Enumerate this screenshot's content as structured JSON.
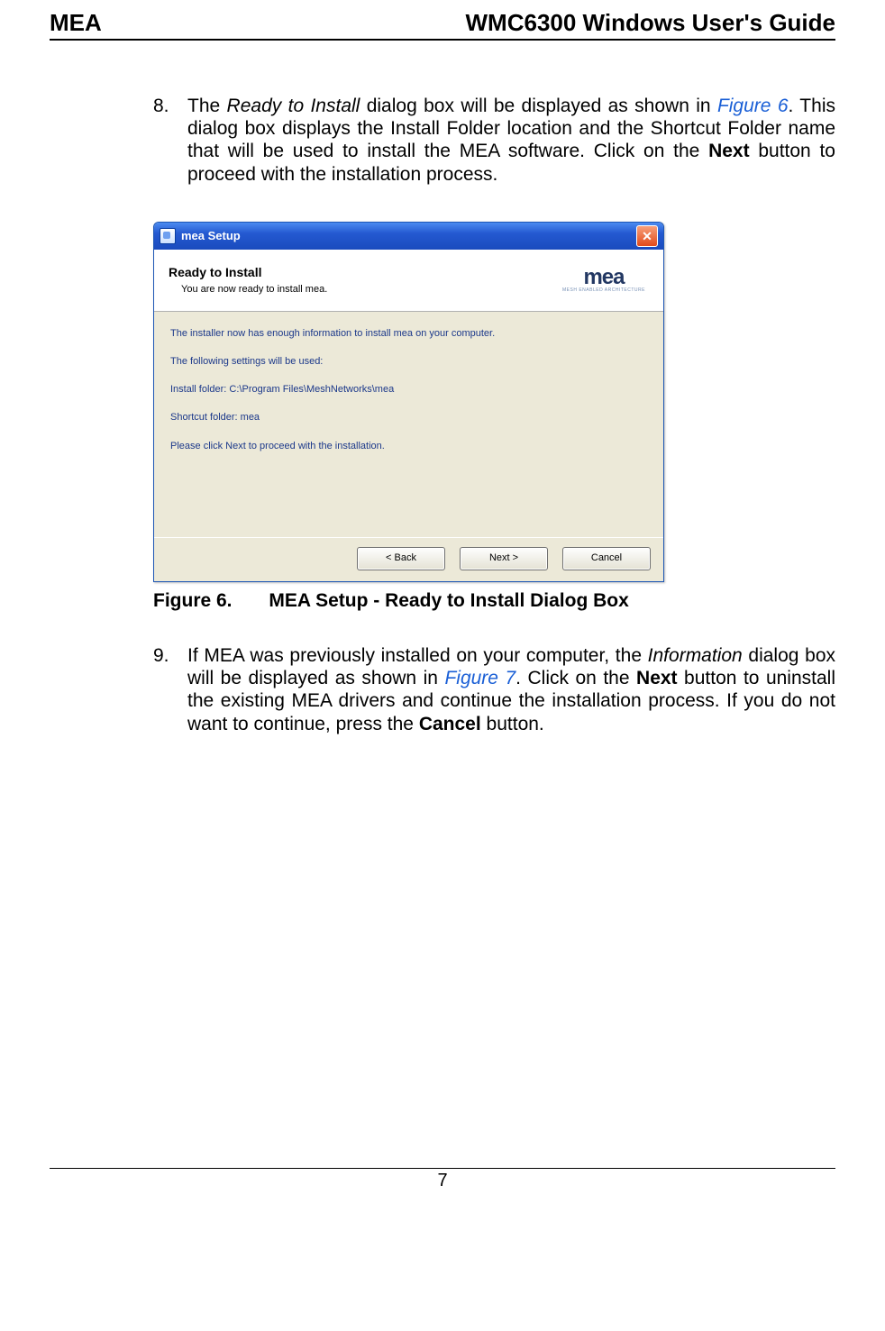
{
  "header": {
    "left": "MEA",
    "right": "WMC6300 Windows User's Guide"
  },
  "steps": {
    "eight": {
      "num": "8.",
      "text_a": "The ",
      "italic_a": "Ready to Install",
      "text_b": " dialog box will be displayed as shown in ",
      "figref": "Figure 6",
      "text_c": ".  This dialog box displays the Install Folder location and the Shortcut Folder name that will be used to install the MEA software.   Click on the ",
      "bold_a": "Next",
      "text_d": " button to proceed with the installation process."
    },
    "nine": {
      "num": "9.",
      "text_a": "If MEA was previously installed on your computer, the ",
      "italic_a": "Information",
      "text_b": " dialog box will be displayed as shown in ",
      "figref": "Figure 7",
      "text_c": ".   Click on the ",
      "bold_a": "Next",
      "text_d": " button to uninstall the existing MEA drivers and continue the installation process.  If you do not want to continue, press the ",
      "bold_b": "Cancel",
      "text_e": " button."
    }
  },
  "dialog": {
    "title": "mea Setup",
    "banner_title": "Ready to Install",
    "banner_sub": "You are now ready to install mea.",
    "logo_main": "mea",
    "logo_sub": "MESH ENABLED ARCHITECTURE",
    "lines": {
      "l1": "The installer now has enough information to install mea on your computer.",
      "l2": "The following settings will be used:",
      "l3": "Install folder: C:\\Program Files\\MeshNetworks\\mea",
      "l4": "Shortcut folder: mea",
      "l5": "Please click Next to proceed with the installation."
    },
    "buttons": {
      "back": "< Back",
      "next": "Next >",
      "cancel": "Cancel"
    }
  },
  "caption": {
    "label": "Figure 6.",
    "text": "MEA Setup - Ready to Install Dialog Box"
  },
  "footer": {
    "page": "7"
  }
}
